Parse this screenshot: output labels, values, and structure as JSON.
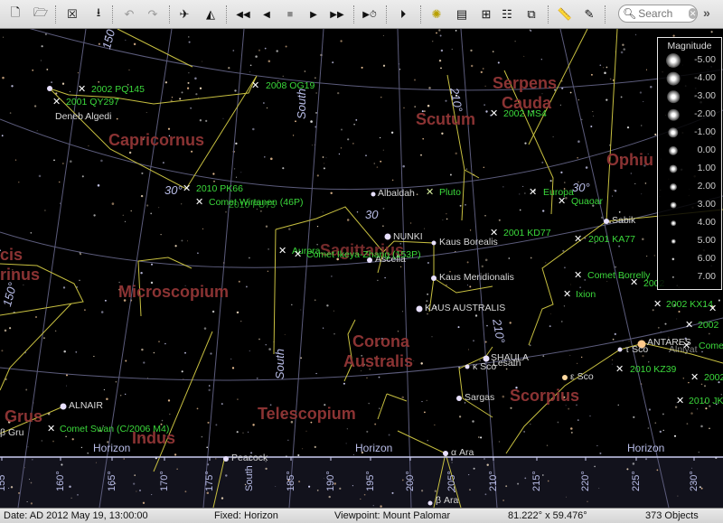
{
  "toolbar": {
    "buttons": [
      {
        "name": "new-document",
        "glyph": "🗋",
        "enabled": true
      },
      {
        "name": "open-document",
        "glyph": "🗁",
        "enabled": true
      },
      {
        "name": "close-document",
        "glyph": "☒",
        "enabled": true
      },
      {
        "name": "save-document",
        "glyph": "⭳",
        "enabled": true
      },
      {
        "name": "undo",
        "glyph": "↶",
        "enabled": false
      },
      {
        "name": "redo",
        "glyph": "↷",
        "enabled": false
      },
      {
        "name": "telescope-slew",
        "glyph": "✈",
        "enabled": true
      },
      {
        "name": "telescope-sync",
        "glyph": "◭",
        "enabled": true
      },
      {
        "name": "fast-reverse",
        "glyph": "◀◀",
        "enabled": true
      },
      {
        "name": "step-reverse",
        "glyph": "◀",
        "enabled": true
      },
      {
        "name": "stop",
        "glyph": "■",
        "enabled": false
      },
      {
        "name": "step-forward",
        "glyph": "▶",
        "enabled": true
      },
      {
        "name": "fast-forward",
        "glyph": "▶▶",
        "enabled": true
      },
      {
        "name": "set-time-now",
        "glyph": "▶⏱",
        "enabled": true
      },
      {
        "name": "slideshow",
        "glyph": "⏵",
        "enabled": true
      },
      {
        "name": "sky-chart-window",
        "glyph": "✺",
        "enabled": true
      },
      {
        "name": "data-table",
        "glyph": "▤",
        "enabled": true
      },
      {
        "name": "hierarchy",
        "glyph": "⊞",
        "enabled": true
      },
      {
        "name": "list-view",
        "glyph": "☷",
        "enabled": true
      },
      {
        "name": "windows",
        "glyph": "⧉",
        "enabled": true
      },
      {
        "name": "measure-tool",
        "glyph": "📏",
        "enabled": true
      },
      {
        "name": "notes",
        "glyph": "✎",
        "enabled": true
      }
    ],
    "search": {
      "placeholder": "Search",
      "value": ""
    },
    "overflow_glyph": "»"
  },
  "legend": {
    "title": "Magnitude",
    "entries": [
      "-5.00",
      "-4.00",
      "-3.00",
      "-2.00",
      "-1.00",
      "0.00",
      "1.00",
      "2.00",
      "3.00",
      "4.00",
      "5.00",
      "6.00",
      "7.00"
    ]
  },
  "constellations": [
    "Capricornus",
    "Scutum",
    "Serpens",
    "Cauda",
    "Ophiu",
    "Sagittarius",
    "Microscopium",
    "Corona",
    "Australis",
    "Telescopium",
    "Scorpius",
    "Grus",
    "Indus",
    "cis",
    "rinus"
  ],
  "stars": [
    "Deneb Algedi",
    "Albaldah",
    "NUNKI",
    "Kaus Borealis",
    "Ascella",
    "Kaus Meridionalis",
    "KAUS AUSTRALIS",
    "Sabik",
    "SHAULA",
    "Lesath",
    "κ Sco",
    "Sargas",
    "ε Sco",
    "τ Sco",
    "ANTARES",
    "Alniyat",
    "ALNAIR",
    "β Gru",
    "Peacock",
    "α Ara",
    "β Ara"
  ],
  "objects": [
    "2002 PQ145",
    "2001 QY297",
    "2008 OG19",
    "2010 PK66",
    "Comet Wirtanen (46P)",
    "2010 FU75",
    "Pluto",
    "2002 MS4",
    "Europa",
    "Quaoar",
    "2001 KD77",
    "2001 KA77",
    "Aurora",
    "Comet Ikeya-Zhang (153P)",
    "Comet Borrelly",
    "2002 KX14",
    "2002",
    "Ixion",
    "2010 KZ39",
    "2010 JK",
    "Comet Swan (C/2006 M4)",
    "Comet"
  ],
  "grid_labels": {
    "alt_30_a": "30°",
    "alt_30_b": "30",
    "alt_30_c": "30°",
    "az_210_a": "210°",
    "az_210_b": "210°",
    "south_a": "South",
    "south_b": "South",
    "ra_150": "150°",
    "ra_150b": "150°"
  },
  "horizon": {
    "label": "Horizon",
    "azimuths": [
      "155°",
      "160°",
      "165°",
      "170°",
      "175°",
      "South",
      "185°",
      "190°",
      "195°",
      "200°",
      "205°",
      "210°",
      "215°",
      "220°",
      "225°",
      "230°"
    ]
  },
  "status": {
    "date": "Date: AD 2012 May 19, 13:00:00",
    "fixed": "Fixed: Horizon",
    "viewpoint": "Viewpoint: Mount Palomar",
    "fov": "81.222° x 59.476°",
    "objects": "373 Objects"
  },
  "colors": {
    "constellation_label": "#8b3333",
    "constellation_line": "#c8c040",
    "object_label": "#3bd93b",
    "grid": "#6a6a8c",
    "horizon": "#c9cbf0"
  }
}
